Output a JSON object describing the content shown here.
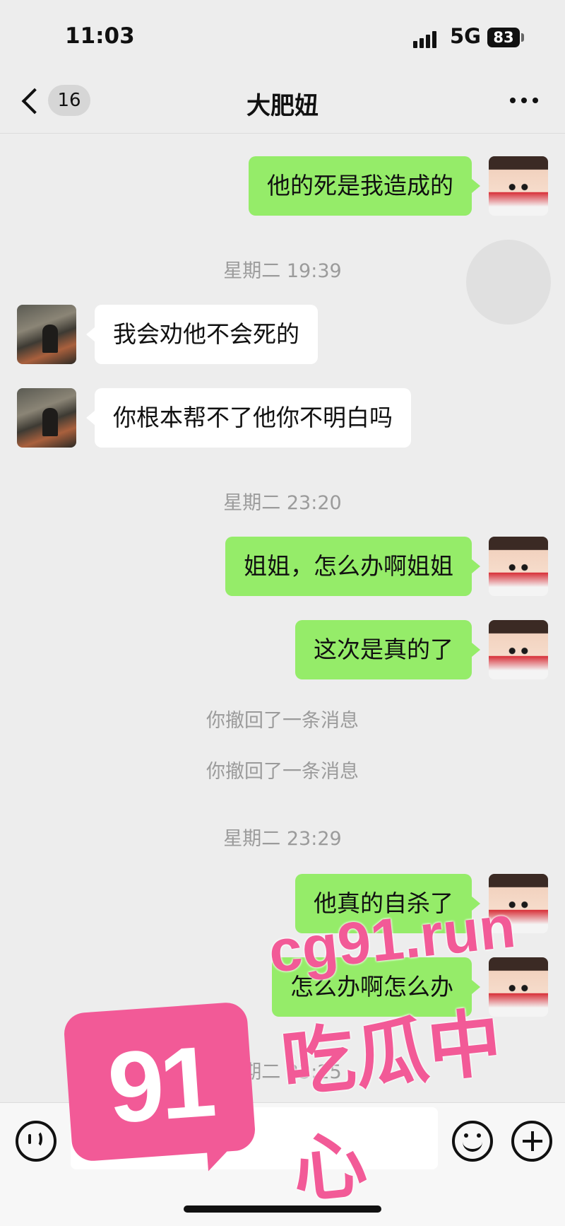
{
  "status_bar": {
    "time": "11:03",
    "network": "5G",
    "battery": "83"
  },
  "nav": {
    "unread_count": "16",
    "title": "大肥妞"
  },
  "messages": [
    {
      "sender": "me",
      "text": "他的死是我造成的"
    },
    {
      "timestamp": "星期二 19:39"
    },
    {
      "sender": "them",
      "text": "我会劝他不会死的"
    },
    {
      "sender": "them",
      "text": "你根本帮不了他你不明白吗"
    },
    {
      "timestamp": "星期二 23:20"
    },
    {
      "sender": "me",
      "text": "姐姐，怎么办啊姐姐"
    },
    {
      "sender": "me",
      "text": "这次是真的了"
    },
    {
      "system": "你撤回了一条消息"
    },
    {
      "system": "你撤回了一条消息"
    },
    {
      "timestamp": "星期二 23:29"
    },
    {
      "sender": "me",
      "text": "他真的自杀了"
    },
    {
      "sender": "me",
      "text": "怎么办啊怎么办"
    },
    {
      "timestamp": "星期二 23:25"
    }
  ],
  "input_bar": {
    "placeholder": ""
  },
  "watermark": {
    "badge": "91",
    "url": "cg91.run",
    "name": "吃瓜中心",
    "color": "#f25a97"
  },
  "colors": {
    "my_bubble": "#95ec69",
    "their_bubble": "#ffffff",
    "background": "#ededed",
    "timestamp_text": "#9b9b9b"
  },
  "icons": [
    "signal-icon",
    "battery-icon",
    "back-chevron-icon",
    "more-icon",
    "voice-icon",
    "emoji-icon",
    "plus-icon"
  ]
}
